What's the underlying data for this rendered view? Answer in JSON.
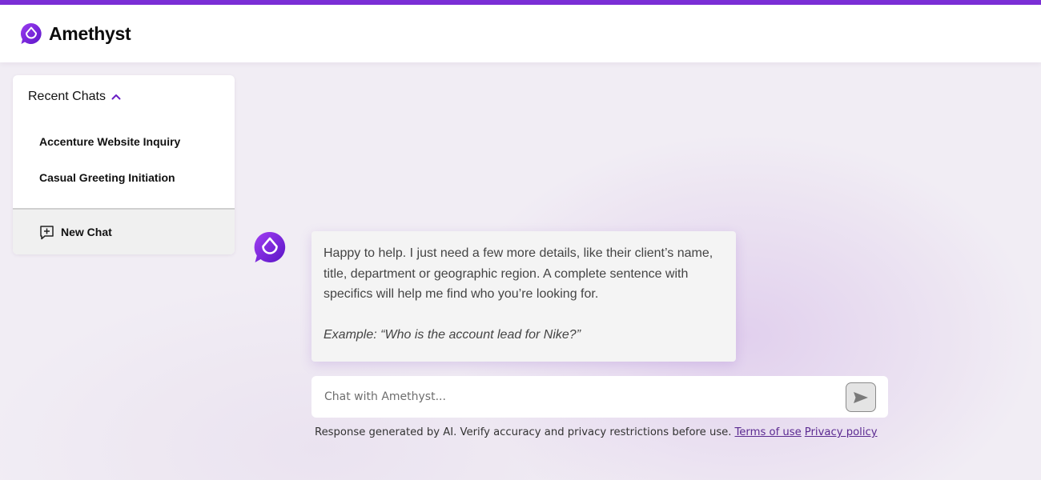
{
  "header": {
    "brand": "Amethyst",
    "logo_icon": "amethyst-drop-icon",
    "accent_color": "#7b2fd6"
  },
  "sidebar": {
    "title": "Recent Chats",
    "toggle_icon": "chevron-up-icon",
    "items": [
      {
        "label": "Accenture Website Inquiry"
      },
      {
        "label": "Casual Greeting Initiation"
      }
    ],
    "new_chat": {
      "label": "New Chat",
      "icon": "new-chat-icon"
    }
  },
  "conversation": {
    "messages": [
      {
        "sender": "assistant",
        "text": "Happy to help. I just need a few more details, like their client’s name, title, department or geographic region. A complete sentence with specifics will help me find who you’re looking for.",
        "example": "Example: “Who is the account lead for Nike?”"
      }
    ]
  },
  "composer": {
    "placeholder": "Chat with Amethyst...",
    "value": "",
    "send_icon": "send-icon"
  },
  "footer": {
    "disclaimer": "Response generated by AI. Verify accuracy and privacy restrictions before use.",
    "terms_label": "Terms of use",
    "privacy_label": "Privacy policy"
  }
}
